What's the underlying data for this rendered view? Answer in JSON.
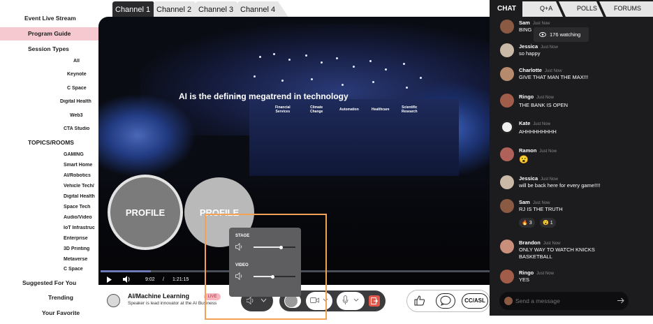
{
  "sidebar": {
    "event_live_stream": "Event Live Stream",
    "program_guide": "Program Guide",
    "session_types": "Session Types",
    "session_items": [
      "All",
      "Keynote",
      "C Space",
      "Digital Health",
      "Web3",
      "CTA Studio"
    ],
    "topics_rooms": "TOPICS/ROOMS",
    "topic_items": [
      "GAMING",
      "Smart Home",
      "AI/Robotics",
      "Vehicle Tech/",
      "Digital Health",
      "Space Tech",
      "Audio/Video",
      "IoT Infrastruc",
      "Enterprise",
      "3D Printing",
      "Metaverse",
      "C Space"
    ],
    "suggested": "Suggested For You",
    "trending": "Trending",
    "favorite": "Your Favorite"
  },
  "tabs": [
    "Channel 1",
    "Channel 2",
    "Channel 3",
    "Channel 4"
  ],
  "video": {
    "screen_title": "AI is the defining megatrend in technology",
    "categories": [
      "Financial\nServices",
      "Climate\nChange",
      "Automation",
      "Healthcare",
      "Scientific\nResearch"
    ],
    "profile_1": "PROFILE",
    "profile_2": "PROFILE",
    "current_time": "9:02",
    "separator": "/",
    "total_time": "1:21:15",
    "progress": 0.13
  },
  "session": {
    "title": "AI/Machine Learning",
    "badge": "LIVE",
    "subtitle": "Speaker is lead innovator at the AI Business",
    "cc_label": "CC/ASL"
  },
  "volume_popup": {
    "stage_label": "STAGE",
    "stage_level": 0.65,
    "video_label": "VIDEO",
    "video_level": 0.45
  },
  "chat": {
    "tabs": [
      "CHAT",
      "Q+A",
      "POLLS",
      "FORUMS"
    ],
    "watching": "176 watching",
    "messages": [
      {
        "name": "Sam",
        "time": "Just Now",
        "text": "BING"
      },
      {
        "name": "Jessica",
        "time": "Just Now",
        "text": "so happy"
      },
      {
        "name": "Charlotte",
        "time": "Just Now",
        "text": "GIVE THAT MAN THE MAX!!!"
      },
      {
        "name": "Ringo",
        "time": "Just Now",
        "text": "THE BANK IS OPEN"
      },
      {
        "name": "Kate",
        "time": "Just Now",
        "text": "AHHHHHHHHH"
      },
      {
        "name": "Ramon",
        "time": "Just Now",
        "text": "😮"
      },
      {
        "name": "Jessica",
        "time": "Just Now",
        "text": "will be back here for every game!!!!"
      },
      {
        "name": "Sam",
        "time": "Just Now",
        "text": "RJ IS THE TRUTH"
      },
      {
        "name": "Brandon",
        "time": "Just Now",
        "text": "ONLY WAY TO WATCH KNICKS\nBASKETBALL"
      },
      {
        "name": "Ringo",
        "time": "Just Now",
        "text": "YES"
      }
    ],
    "reactions": [
      {
        "emoji": "🔥",
        "count": "3"
      },
      {
        "emoji": "😮",
        "count": "1"
      }
    ],
    "input_placeholder": "Send a message"
  },
  "colors": {
    "accent_pink": "#f5c9cf",
    "chat_bg": "#1c1c1e",
    "highlight_orange": "#f2a155",
    "live_badge": "#f5b6bf"
  }
}
